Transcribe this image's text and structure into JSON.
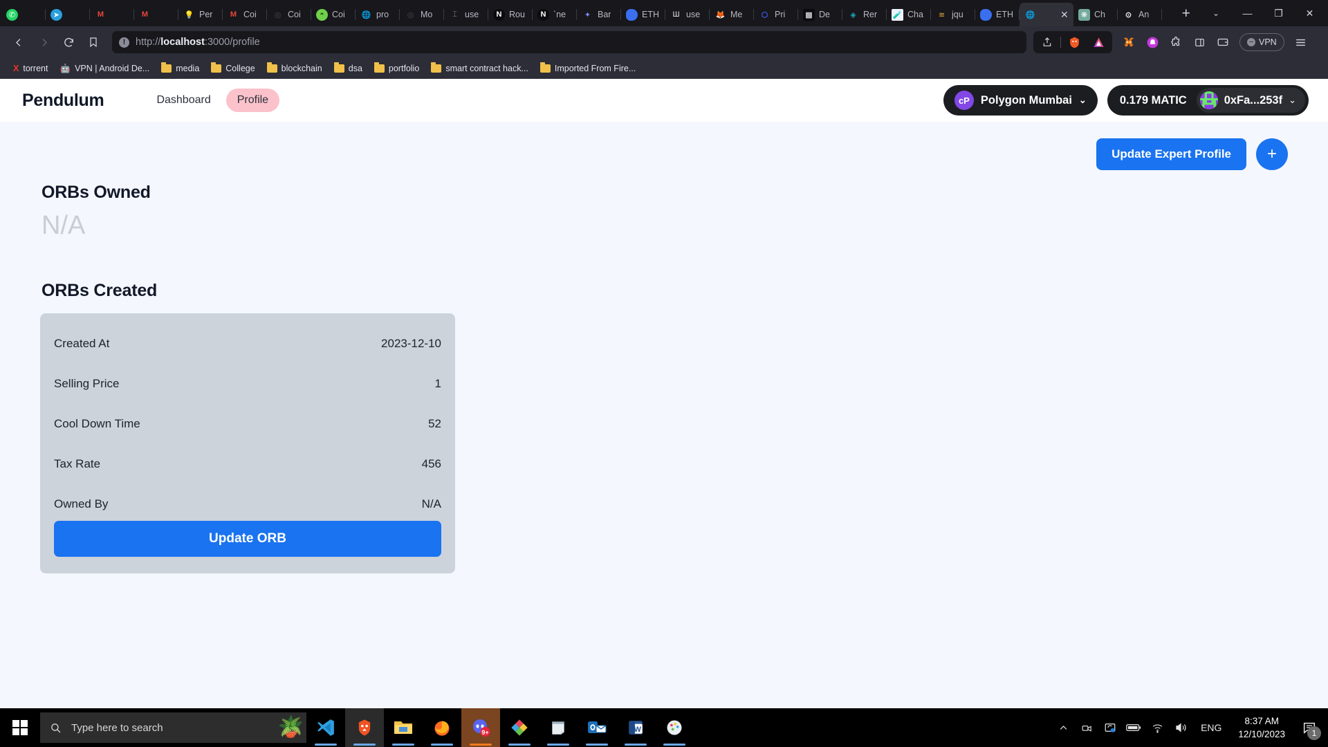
{
  "browser": {
    "tabs": [
      {
        "label": "",
        "icon": "whatsapp-icon"
      },
      {
        "label": "",
        "icon": "telegram-icon"
      },
      {
        "label": "",
        "icon": "gmail-icon"
      },
      {
        "label": "",
        "icon": "gmail-icon"
      },
      {
        "label": "Per",
        "icon": "idea-bulb-icon"
      },
      {
        "label": "Coi",
        "icon": "gmail-icon"
      },
      {
        "label": "Coi",
        "icon": "coinmarketcap-icon"
      },
      {
        "label": "Coi",
        "icon": "greenball-icon"
      },
      {
        "label": "pro",
        "icon": "globe-icon"
      },
      {
        "label": "Mo",
        "icon": "coinmarketcap-icon"
      },
      {
        "label": "use",
        "icon": "tailwind-icon"
      },
      {
        "label": "Rou",
        "icon": "nextjs-icon"
      },
      {
        "label": "`ne",
        "icon": "nextjs-icon"
      },
      {
        "label": "Bar",
        "icon": "sparkle-icon"
      },
      {
        "label": "ETH",
        "icon": "ethereum-icon"
      },
      {
        "label": "use",
        "icon": "wagmi-icon"
      },
      {
        "label": "Me",
        "icon": "metamask-icon"
      },
      {
        "label": "Pri",
        "icon": "chainlink-icon"
      },
      {
        "label": "De",
        "icon": "checkerboard-icon"
      },
      {
        "label": "Rer",
        "icon": "remix-icon"
      },
      {
        "label": "Cha",
        "icon": "chai-icon"
      },
      {
        "label": "jqu",
        "icon": "jquery-icon"
      },
      {
        "label": "ETH",
        "icon": "ethereum-icon"
      },
      {
        "label": "",
        "icon": "globe-icon",
        "active": true
      },
      {
        "label": "Ch",
        "icon": "chatgpt-icon"
      },
      {
        "label": "An",
        "icon": "github-icon"
      }
    ],
    "new_tab_label": "+",
    "window_controls": {
      "minimize": "—",
      "maximize": "❐",
      "close": "✕",
      "chevron": "⌄"
    },
    "nav": {
      "back": "back-arrow",
      "forward": "forward-arrow",
      "reload": "reload-arrow",
      "bookmark": "bookmark-icon",
      "url": "http://localhost:3000/profile",
      "url_host": "localhost",
      "url_scheme": "http://",
      "url_path": ":3000/profile",
      "info_glyph": "!",
      "vpn_label": "VPN"
    },
    "bookmarks": [
      {
        "label": "torrent",
        "icon": "utorrent-icon"
      },
      {
        "label": "VPN | Android De...",
        "icon": "android-icon"
      },
      {
        "label": "media",
        "icon": "folder-icon"
      },
      {
        "label": "College",
        "icon": "folder-icon"
      },
      {
        "label": "blockchain",
        "icon": "folder-icon"
      },
      {
        "label": "dsa",
        "icon": "folder-icon"
      },
      {
        "label": "portfolio",
        "icon": "folder-icon"
      },
      {
        "label": "smart contract hack...",
        "icon": "folder-icon"
      },
      {
        "label": "Imported From Fire...",
        "icon": "folder-icon"
      }
    ]
  },
  "app": {
    "brand": "Pendulum",
    "nav_links": [
      {
        "label": "Dashboard",
        "active": false
      },
      {
        "label": "Profile",
        "active": true
      }
    ],
    "network": {
      "name": "Polygon Mumbai",
      "caret": "⌄",
      "logo_text": "cP"
    },
    "account": {
      "balance": "0.179 MATIC",
      "address": "0xFa...253f",
      "caret": "⌄"
    },
    "actions": {
      "update_expert_profile": "Update Expert Profile",
      "add": "+"
    },
    "orbs_owned": {
      "title": "ORBs Owned",
      "value": "N/A"
    },
    "orbs_created": {
      "title": "ORBs Created",
      "rows": [
        {
          "key": "Created At",
          "value": "2023-12-10"
        },
        {
          "key": "Selling Price",
          "value": "1"
        },
        {
          "key": "Cool Down Time",
          "value": "52"
        },
        {
          "key": "Tax Rate",
          "value": "456"
        },
        {
          "key": "Owned By",
          "value": "N/A"
        }
      ],
      "button": "Update ORB"
    },
    "colors": {
      "accent": "#1a73f0",
      "pink_pill": "#fbc2cb",
      "card_bg": "#ccd3db",
      "page_bg": "#f4f7fd"
    }
  },
  "taskbar": {
    "search_placeholder": "Type here to search",
    "apps": [
      {
        "name": "vscode-icon"
      },
      {
        "name": "brave-icon"
      },
      {
        "name": "file-explorer-icon"
      },
      {
        "name": "firefox-icon"
      },
      {
        "name": "discord-icon",
        "badge": "9+"
      },
      {
        "name": "photos-icon"
      },
      {
        "name": "sticky-notes-icon"
      },
      {
        "name": "outlook-icon"
      },
      {
        "name": "word-icon"
      },
      {
        "name": "paint-icon"
      }
    ],
    "tray": {
      "language": "ENG",
      "time": "8:37 AM",
      "date": "12/10/2023",
      "notification_count": "1"
    }
  }
}
